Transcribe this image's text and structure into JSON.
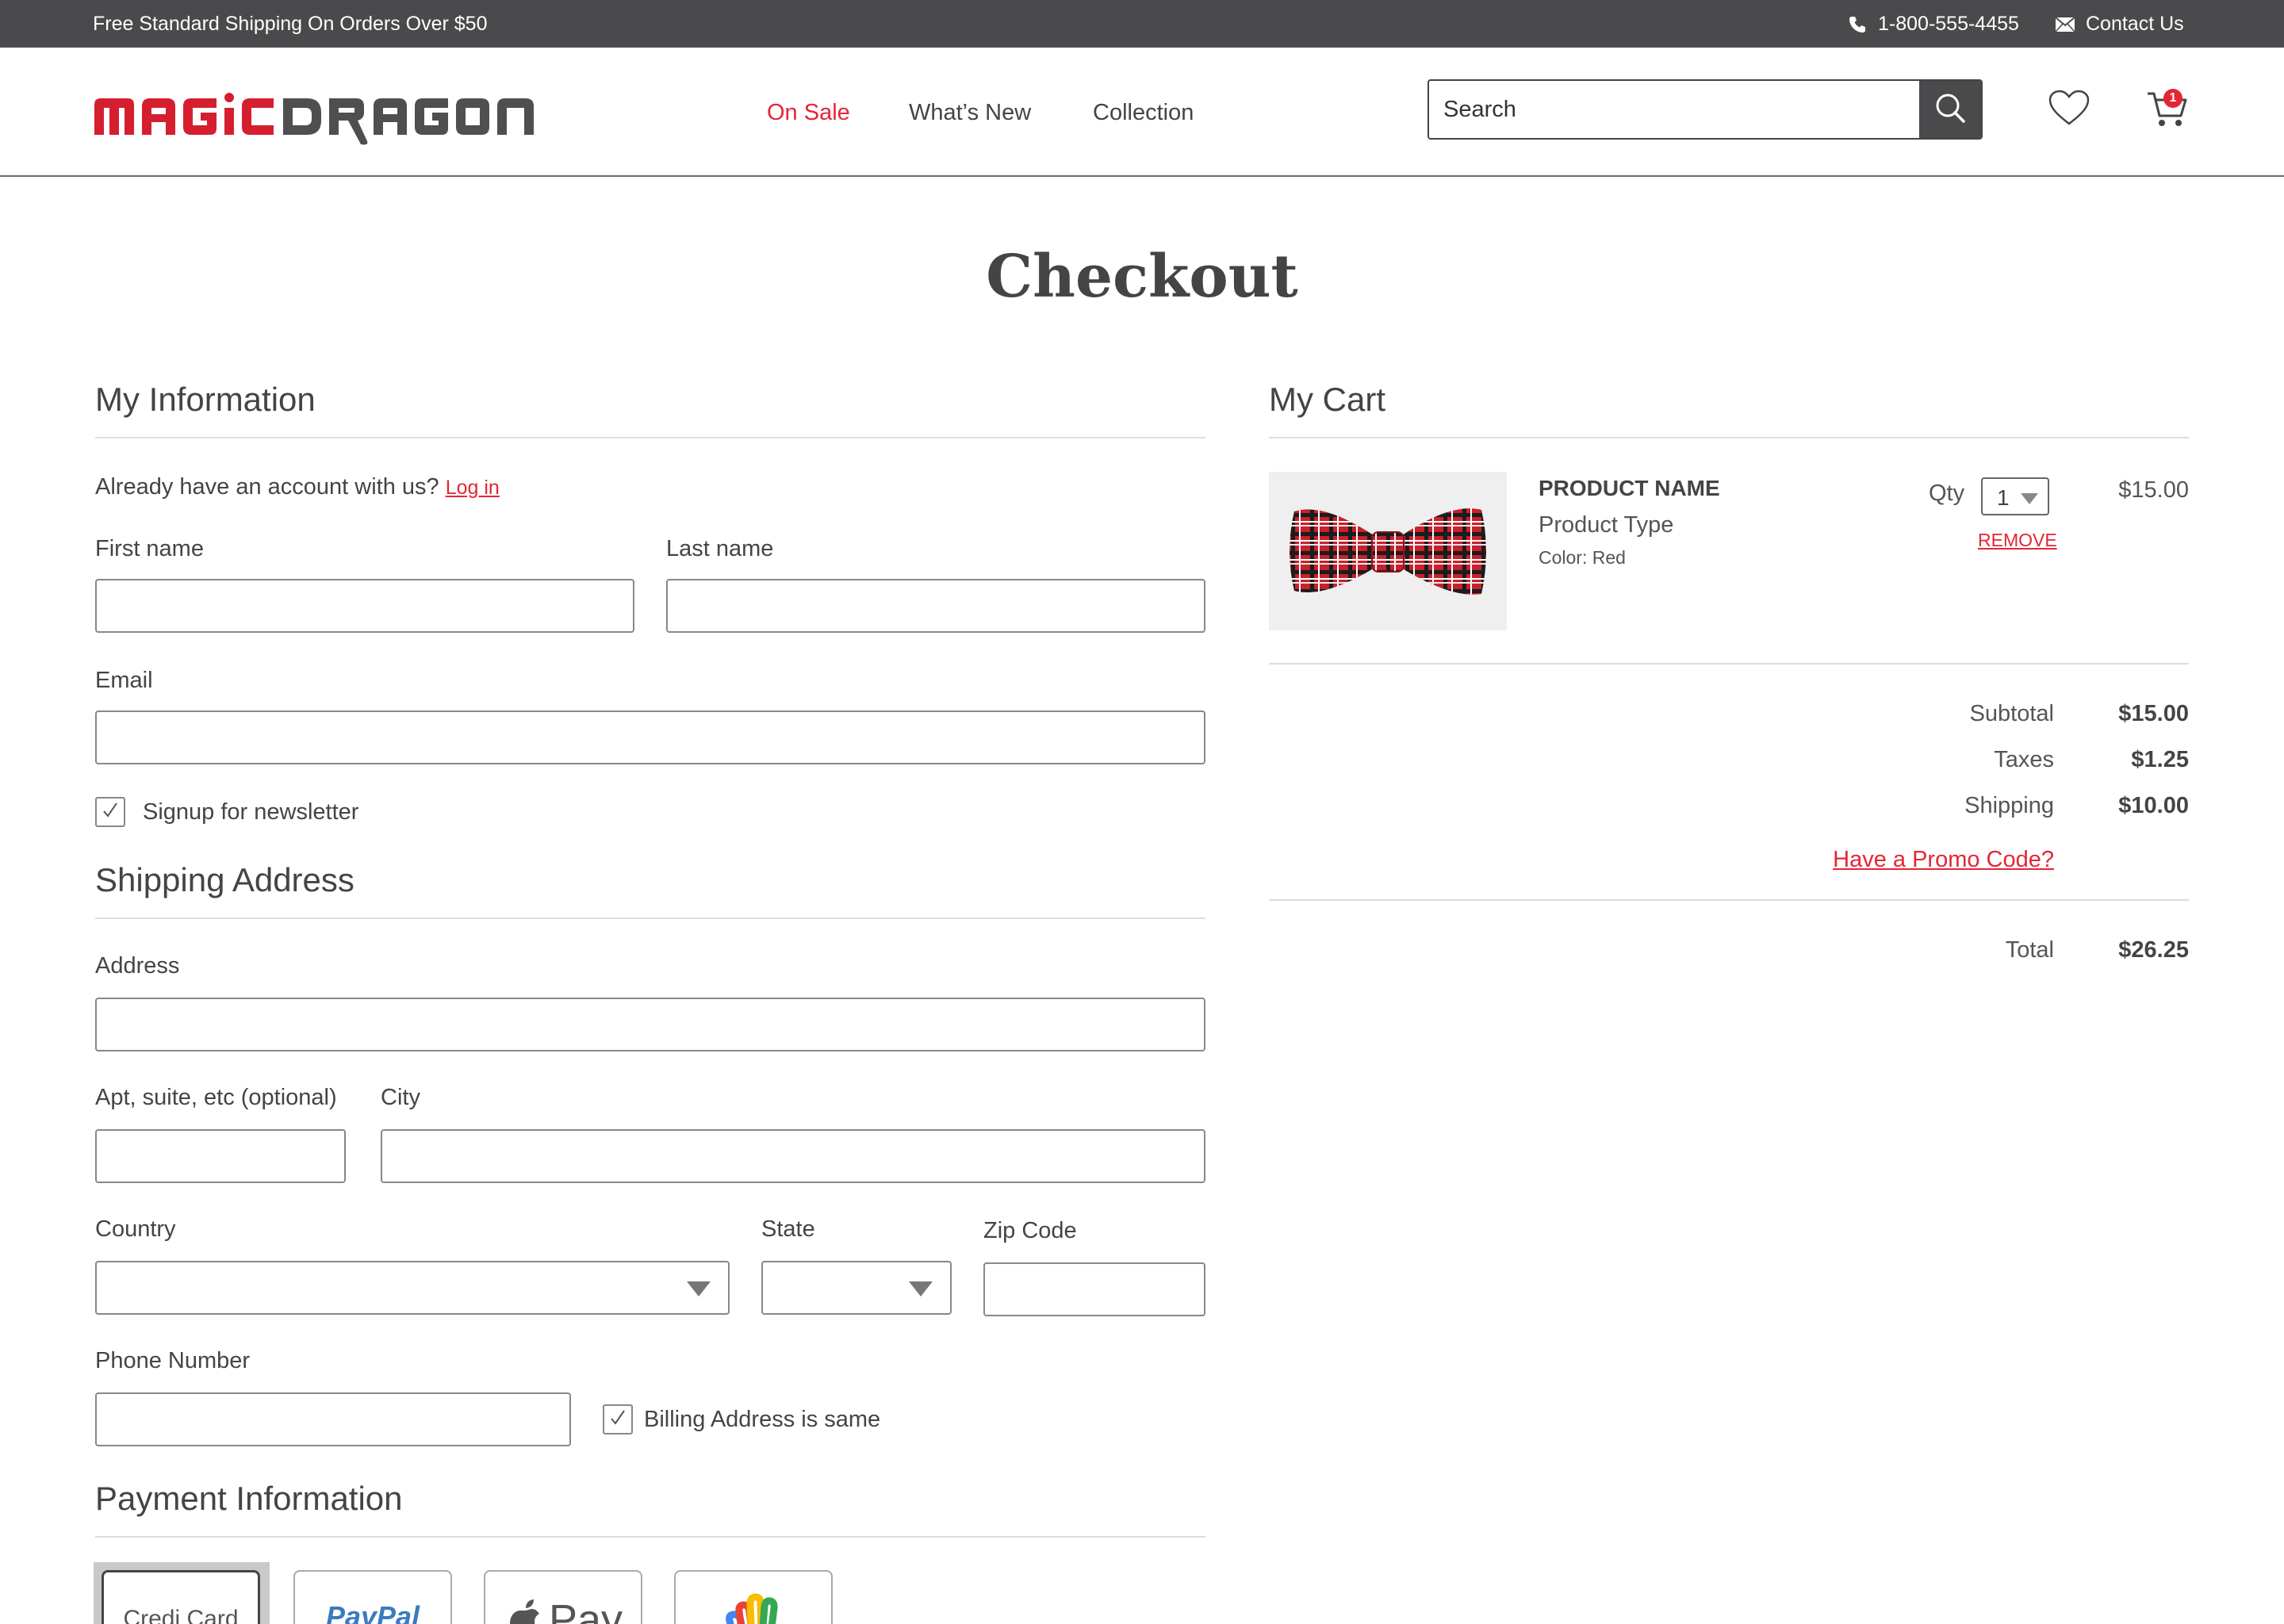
{
  "topbar": {
    "promo_text": "Free Standard Shipping On Orders Over $50",
    "phone": "1-800-555-4455",
    "contact_label": "Contact Us"
  },
  "header": {
    "logo_text_part1": "MAGIC",
    "logo_text_part2": "DRAGON",
    "nav": [
      {
        "label": "On Sale",
        "active": true
      },
      {
        "label": "What’s New",
        "active": false
      },
      {
        "label": "Collection",
        "active": false
      }
    ],
    "search_placeholder": "Search",
    "cart_count": "1"
  },
  "page_title": "Checkout",
  "my_information": {
    "title": "My Information",
    "account_prompt": "Already have an account with us?",
    "login_link": "Log in",
    "first_name_label": "First name",
    "first_name_value": "",
    "last_name_label": "Last name",
    "last_name_value": "",
    "email_label": "Email",
    "email_value": "",
    "newsletter_label": "Signup for newsletter",
    "newsletter_checked": true
  },
  "shipping_address": {
    "title": "Shipping Address",
    "address_label": "Address",
    "address_value": "",
    "apt_label": "Apt, suite, etc (optional)",
    "apt_value": "",
    "city_label": "City",
    "city_value": "",
    "country_label": "Country",
    "country_value": "",
    "state_label": "State",
    "state_value": "",
    "zip_label": "Zip Code",
    "zip_value": "",
    "phone_label": "Phone Number",
    "phone_value": "",
    "billing_same_label": "Billing Address is same",
    "billing_same_checked": true
  },
  "payment": {
    "title": "Payment Information",
    "methods": [
      {
        "label": "Credi Card",
        "selected": true
      },
      {
        "label": "PayPal",
        "selected": false
      },
      {
        "label": "Pay",
        "selected": false
      },
      {
        "label": "",
        "selected": false
      }
    ]
  },
  "cart": {
    "title": "My Cart",
    "item": {
      "name": "PRODUCT NAME",
      "type": "Product Type",
      "color": "Color: Red",
      "qty_label": "Qty",
      "qty_value": "1",
      "remove_label": "REMOVE",
      "price": "$15.00"
    },
    "summary": {
      "subtotal_label": "Subtotal",
      "subtotal_value": "$15.00",
      "taxes_label": "Taxes",
      "taxes_value": "$1.25",
      "shipping_label": "Shipping",
      "shipping_value": "$10.00",
      "promo_link": "Have a Promo Code?",
      "total_label": "Total",
      "total_value": "$26.25"
    }
  },
  "colors": {
    "accent": "#e32636",
    "topbar_bg": "#4a4a4c",
    "text": "#444444",
    "border": "#888888"
  }
}
